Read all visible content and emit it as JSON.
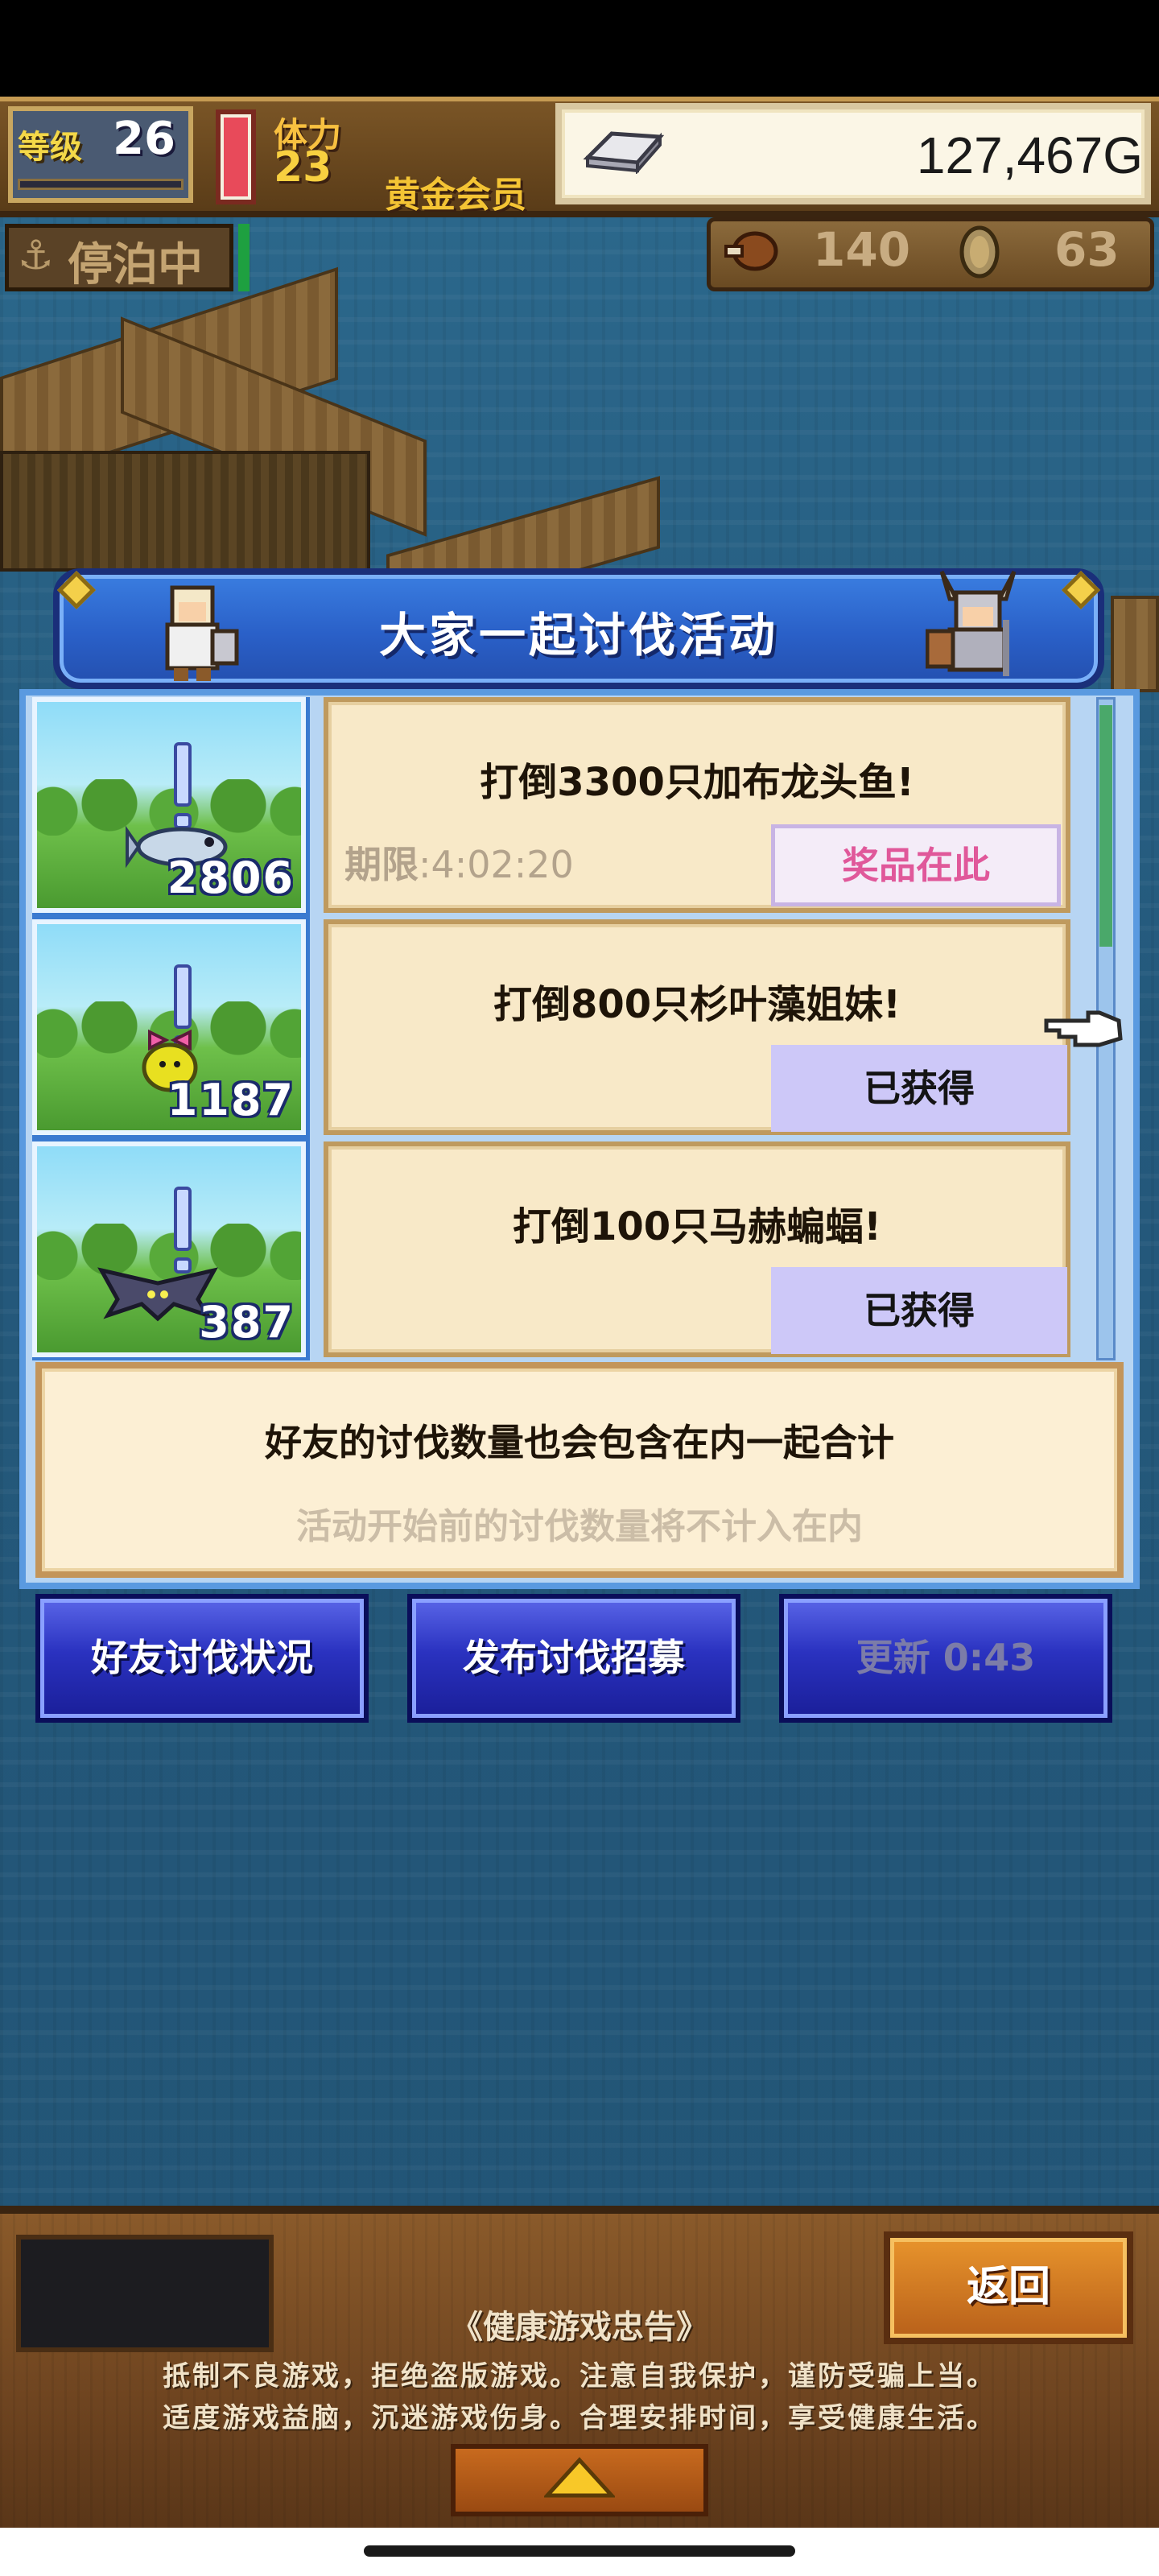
{
  "hud": {
    "level_label": "等级",
    "level_value": "26",
    "stamina_label": "体力",
    "stamina_value": "23",
    "member_label": "黄金会员",
    "gold_value": "127,467G",
    "moor_icon": "anchor-icon",
    "moor_label": "停泊中",
    "meat_value": "140",
    "coin_value": "63"
  },
  "event": {
    "title": "大家一起讨伐活动",
    "rows": [
      {
        "count": "2806",
        "monster_icon": "fish-icon",
        "goal": "打倒3300只加布龙头鱼!",
        "deadline_label": "期限",
        "deadline_value": ":4:02:20",
        "button": "奖品在此"
      },
      {
        "count": "1187",
        "monster_icon": "seaweed-girl-icon",
        "goal": "打倒800只杉叶藻姐妹!",
        "button": "已获得"
      },
      {
        "count": "387",
        "monster_icon": "bat-icon",
        "goal": "打倒100只马赫蝙蝠!",
        "button": "已获得"
      }
    ],
    "info_main": "好友的讨伐数量也会包含在内一起合计",
    "info_sub": "活动开始前的讨伐数量将不计入在内"
  },
  "actions": {
    "friend_status": "好友讨伐状况",
    "post_recruit": "发布讨伐招募",
    "refresh": "更新 0:43"
  },
  "bottom": {
    "back": "返回",
    "notice_title": "《健康游戏忠告》",
    "notice_line1": "抵制不良游戏，拒绝盗版游戏。注意自我保护，谨防受骗上当。",
    "notice_line2": "适度游戏益脑，沉迷游戏伤身。合理安排时间，享受健康生活。"
  },
  "colors": {
    "panel_blue": "#2a60c8",
    "card_bg": "#f8e9c8",
    "reward_pink": "#e0589a",
    "claimed_lavender": "#cdc8f8",
    "button_blue": "#2a32c0"
  }
}
